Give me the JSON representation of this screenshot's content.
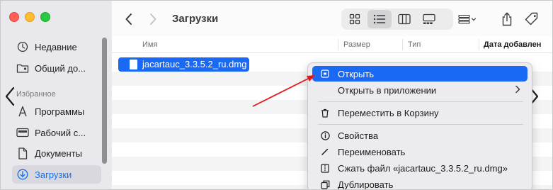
{
  "window": {
    "title": "Загрузки"
  },
  "sidebar": {
    "section_label": "Избранное",
    "items": [
      {
        "label": "Недавние",
        "icon": "clock-icon"
      },
      {
        "label": "Общий до...",
        "icon": "shared-folder-icon"
      },
      {
        "label": "Программы",
        "icon": "applications-icon"
      },
      {
        "label": "Рабочий с...",
        "icon": "desktop-icon"
      },
      {
        "label": "Документы",
        "icon": "document-icon"
      },
      {
        "label": "Загрузки",
        "icon": "download-icon",
        "active": true
      }
    ]
  },
  "columns": {
    "name": "Имя",
    "size": "Размер",
    "kind": "Тип",
    "date_added": "Дата добавлен"
  },
  "file": {
    "name": "jacartauc_3.3.5.2_ru.dmg"
  },
  "context_menu": {
    "items": [
      {
        "label": "Открыть",
        "icon": "open-icon",
        "highlighted": true
      },
      {
        "label": "Открыть в приложении",
        "icon": "",
        "submenu": true
      },
      {
        "label": "Переместить в Корзину",
        "icon": "trash-icon"
      },
      {
        "label": "Свойства",
        "icon": "info-icon"
      },
      {
        "label": "Переименовать",
        "icon": "pencil-icon"
      },
      {
        "label": "Сжать файл «jacartauc_3.3.5.2_ru.dmg»",
        "icon": "archive-icon"
      },
      {
        "label": "Дублировать",
        "icon": "duplicate-icon"
      }
    ]
  },
  "colors": {
    "accent": "#1a69f5",
    "sidebar_bg": "#e9e8ed",
    "annotation_arrow": "#e0191b"
  }
}
